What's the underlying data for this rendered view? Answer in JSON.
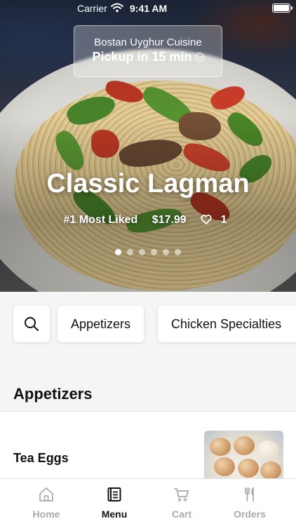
{
  "status_bar": {
    "carrier": "Carrier",
    "time": "9:41 AM"
  },
  "restaurant": {
    "name": "Bostan Uyghur Cuisine",
    "pickup": "Pickup in 15 min"
  },
  "featured": {
    "title": "Classic Lagman",
    "rank": "#1 Most Liked",
    "price": "$17.99",
    "likes": "1",
    "carousel": {
      "count": 6,
      "active_index": 0
    }
  },
  "categories": [
    "Appetizers",
    "Chicken Specialties"
  ],
  "section": {
    "title": "Appetizers"
  },
  "items": [
    {
      "name": "Tea Eggs"
    }
  ],
  "tabbar": {
    "tabs": [
      {
        "label": "Home",
        "icon": "home-icon",
        "active": false
      },
      {
        "label": "Menu",
        "icon": "menu-icon",
        "active": true
      },
      {
        "label": "Cart",
        "icon": "cart-icon",
        "active": false
      },
      {
        "label": "Orders",
        "icon": "fork-knife-icon",
        "active": false
      }
    ]
  },
  "colors": {
    "active_tab": "#111111",
    "inactive_tab": "#aaaaaa",
    "background": "#f5f5f5"
  }
}
